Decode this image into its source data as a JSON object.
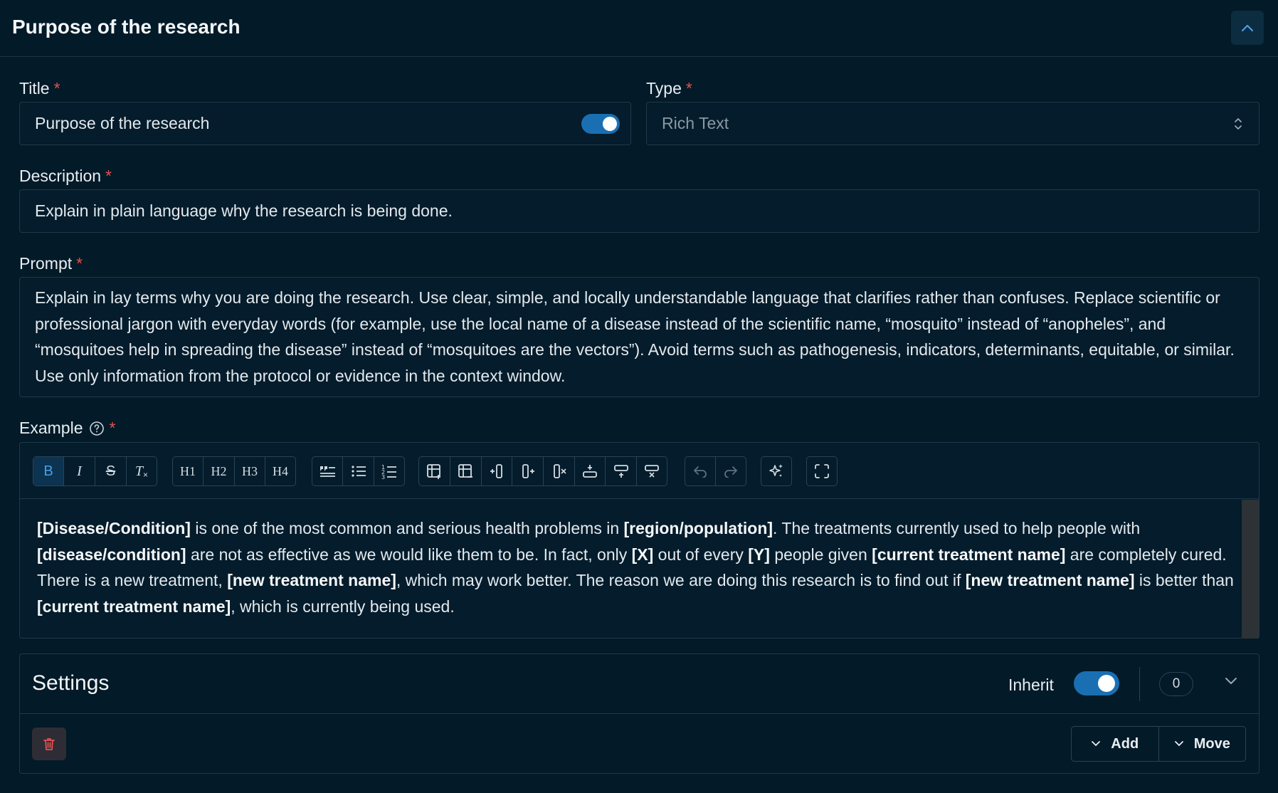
{
  "header": {
    "title": "Purpose of the research"
  },
  "title_field": {
    "label": "Title",
    "required": "*",
    "value": "Purpose of the research"
  },
  "type_field": {
    "label": "Type",
    "required": "*",
    "value": "Rich Text"
  },
  "description_field": {
    "label": "Description",
    "required": "*",
    "value": "Explain in plain language why the research is being done."
  },
  "prompt_field": {
    "label": "Prompt",
    "required": "*",
    "value": "Explain in lay terms why you are doing the research. Use clear, simple, and locally understandable language that clarifies rather than confuses. Replace scientific or professional jargon with everyday words (for example, use the local name of a disease instead of the scientific name, “mosquito” instead of “anopheles”, and “mosquitoes help in spreading the disease” instead of “mosquitoes are the vectors”). Avoid terms such as pathogenesis, indicators, determinants, equitable, or similar. Use only information from the protocol or evidence in the context window."
  },
  "example_field": {
    "label": "Example",
    "required": "*",
    "toolbar": {
      "h1": "H1",
      "h2": "H2",
      "h3": "H3",
      "h4": "H4",
      "bold": "B",
      "italic": "I",
      "strike": "S",
      "clear": "T"
    },
    "content": [
      {
        "text": "[Disease/Condition]",
        "bold": true
      },
      {
        "text": " is one of the most common and serious health problems in ",
        "bold": false
      },
      {
        "text": "[region/population]",
        "bold": true
      },
      {
        "text": ". The treatments currently used to help people with ",
        "bold": false
      },
      {
        "text": "[disease/condition]",
        "bold": true
      },
      {
        "text": " are not as effective as we would like them to be. In fact, only ",
        "bold": false
      },
      {
        "text": "[X]",
        "bold": true
      },
      {
        "text": " out of every ",
        "bold": false
      },
      {
        "text": "[Y]",
        "bold": true
      },
      {
        "text": " people given ",
        "bold": false
      },
      {
        "text": "[current treatment name]",
        "bold": true
      },
      {
        "text": " are completely cured. There is a new treatment, ",
        "bold": false
      },
      {
        "text": "[new treatment name]",
        "bold": true
      },
      {
        "text": ", which may work better. The reason we are doing this research is to find out if ",
        "bold": false
      },
      {
        "text": "[new treatment name]",
        "bold": true
      },
      {
        "text": " is better than ",
        "bold": false
      },
      {
        "text": "[current treatment name]",
        "bold": true
      },
      {
        "text": ", which is currently being used.",
        "bold": false
      }
    ]
  },
  "settings": {
    "title": "Settings",
    "inherit_label": "Inherit",
    "count": "0",
    "add_label": "Add",
    "move_label": "Move"
  },
  "colors": {
    "accent": "#1a6fb3",
    "background": "#031a28",
    "required": "#e05252"
  }
}
